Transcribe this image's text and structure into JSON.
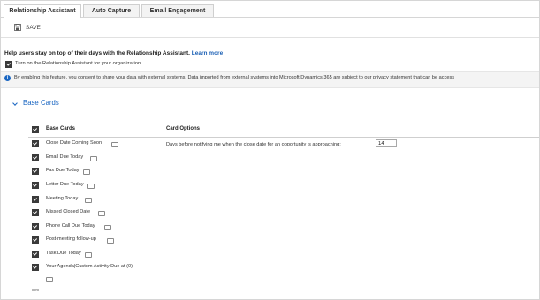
{
  "tabs": [
    {
      "label": "Relationship Assistant",
      "active": true
    },
    {
      "label": "Auto Capture",
      "active": false
    },
    {
      "label": "Email Engagement",
      "active": false
    }
  ],
  "toolbar": {
    "save_label": "SAVE",
    "save_icon": "save-icon"
  },
  "intro": {
    "headline": "Help users stay on top of their days with the Relationship Assistant.",
    "learn_more": "Learn more",
    "turn_on_label": "Turn on the Relationship Assistant for your organization."
  },
  "info": {
    "icon": "info-icon",
    "text": "By enabling this feature, you consent to share your data with external systems. Data imported from external systems into Microsoft Dynamics 365 are subject to our privacy statement that can be access"
  },
  "section": {
    "title": "Base Cards",
    "icon": "chevron-down-icon"
  },
  "table": {
    "col_cards": "Base Cards",
    "col_options": "Card Options",
    "rows": [
      {
        "label": "Close Date Coming Soon"
      },
      {
        "label": "Email Due Today"
      },
      {
        "label": "Fax Due Today"
      },
      {
        "label": "Letter Due Today"
      },
      {
        "label": "Meeting Today"
      },
      {
        "label": "Missed Closed Date"
      },
      {
        "label": "Phone Call Due Today"
      },
      {
        "label": "Post-meeting follow-up"
      },
      {
        "label": "Task Due Today"
      },
      {
        "label": "Your Agenda|Custom Activity Due at (0)"
      }
    ],
    "option_text": "Days before notifying me when the close date for an opportunity is approaching:",
    "option_value": "14"
  },
  "colors": {
    "accent": "#1a66c2",
    "checkbox": "#3a3a3a",
    "infobar": "#f4f4f4"
  }
}
